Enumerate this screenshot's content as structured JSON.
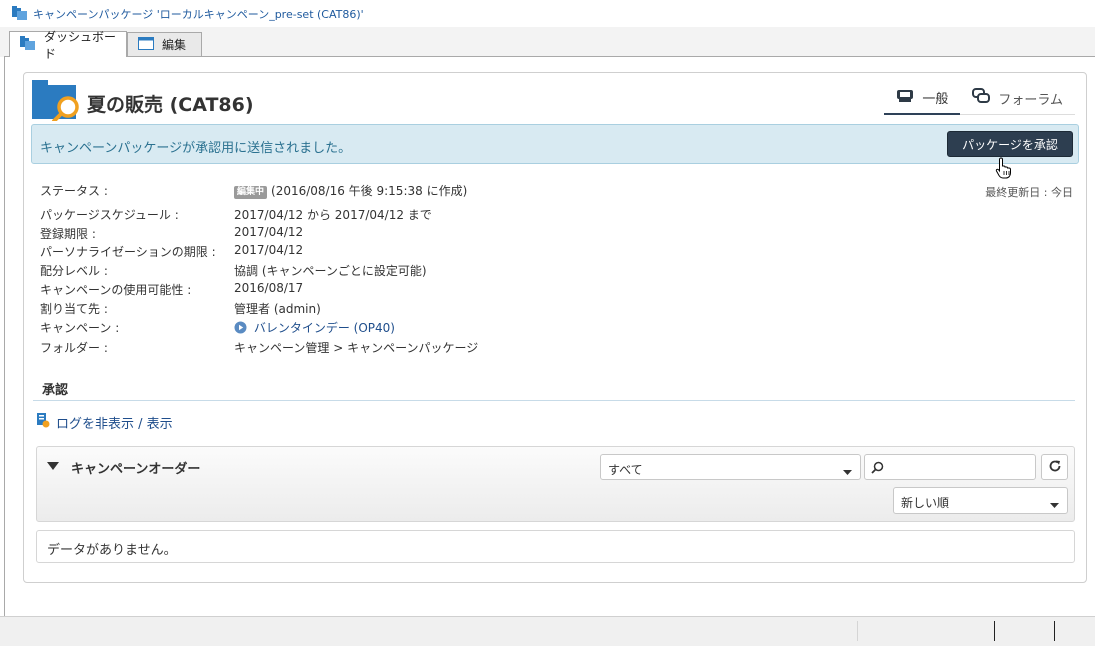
{
  "window": {
    "title": "キャンペーンパッケージ 'ローカルキャンペーン_pre-set (CAT86)'"
  },
  "tabs": [
    {
      "label": "ダッシュボード",
      "active": true
    },
    {
      "label": "編集",
      "active": false
    }
  ],
  "header": {
    "title": "夏の販売 (CAT86)",
    "view_tabs": [
      {
        "label": "一般",
        "active": true
      },
      {
        "label": "フォーラム",
        "active": false
      }
    ]
  },
  "alert": {
    "message": "キャンペーンパッケージが承認用に送信されました。",
    "button_label": "パッケージを承認"
  },
  "last_updated": "最終更新日 : 今日",
  "info": {
    "status": {
      "label": "ステータス :",
      "badge": "編集中",
      "value": "(2016/08/16 午後 9:15:38 に作成)"
    },
    "schedule": {
      "label": "パッケージスケジュール :",
      "value": "2017/04/12 から 2017/04/12 まで"
    },
    "registration": {
      "label": "登録期限 :",
      "value": "2017/04/12"
    },
    "personalization": {
      "label": "パーソナライゼーションの期限 :",
      "value": "2017/04/12"
    },
    "distribution": {
      "label": "配分レベル :",
      "value": "協調 (キャンペーンごとに設定可能)"
    },
    "availability": {
      "label": "キャンペーンの使用可能性 :",
      "value": "2016/08/17"
    },
    "assignee": {
      "label": "割り当て先 :",
      "value": "管理者 (admin)"
    },
    "campaign": {
      "label": "キャンペーン :",
      "value": "バレンタインデー (OP40)"
    },
    "folder": {
      "label": "フォルダー :",
      "value": "キャンペーン管理 > キャンペーンパッケージ"
    }
  },
  "approval": {
    "section_title": "承認",
    "log_toggle": "ログを非表示 / 表示"
  },
  "orders": {
    "title": "キャンペーンオーダー",
    "filter_value": "すべて",
    "search_placeholder": "",
    "sort_value": "新しい順",
    "empty_message": "データがありません。"
  },
  "colors": {
    "accent": "#2d3e50",
    "link": "#1f4e8c",
    "alert_bg": "#d8eaf2",
    "alert_text": "#2a7190",
    "logo_blue": "#2b7bc0",
    "logo_orange": "#f0a020"
  }
}
